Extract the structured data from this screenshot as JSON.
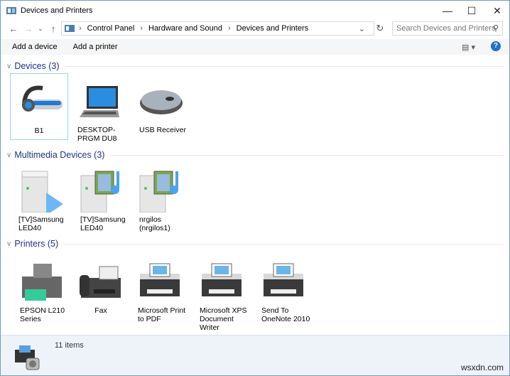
{
  "window": {
    "title": "Devices and Printers",
    "minimize": "—",
    "maximize": "☐",
    "close": "✕"
  },
  "nav": {
    "back": "←",
    "forward": "→",
    "recent": "⌄",
    "up": "↑",
    "breadcrumb": [
      "Control Panel",
      "Hardware and Sound",
      "Devices and Printers"
    ],
    "sep": "›",
    "dropdown": "⌄",
    "refresh": "↻",
    "search_placeholder": "Search Devices and Printers",
    "search_icon": "⚲"
  },
  "toolbar": {
    "add_device": "Add a device",
    "add_printer": "Add a printer",
    "view": "▤ ▾",
    "help": "?"
  },
  "groups": [
    {
      "title": "Devices (3)",
      "items": [
        {
          "label": "B1",
          "icon": "headset-icon"
        },
        {
          "label": "DESKTOP-PRGM DU8",
          "icon": "laptop-icon"
        },
        {
          "label": "USB Receiver",
          "icon": "mouse-icon"
        }
      ]
    },
    {
      "title": "Multimedia Devices (3)",
      "items": [
        {
          "label": "[TV]Samsung LED40",
          "icon": "media-server-play-icon"
        },
        {
          "label": "[TV]Samsung LED40",
          "icon": "media-server-icon"
        },
        {
          "label": "nrgilos (nrgilos1)",
          "icon": "media-server-icon"
        }
      ]
    },
    {
      "title": "Printers (5)",
      "items": [
        {
          "label": "EPSON L210 Series",
          "icon": "printer-icon"
        },
        {
          "label": "Fax",
          "icon": "fax-icon"
        },
        {
          "label": "Microsoft Print to PDF",
          "icon": "printer-icon"
        },
        {
          "label": "Microsoft XPS Document Writer",
          "icon": "printer-icon"
        },
        {
          "label": "Send To OneNote 2010",
          "icon": "printer-icon"
        }
      ]
    }
  ],
  "status": {
    "count": "11 items"
  },
  "watermark": "wsxdn.com"
}
